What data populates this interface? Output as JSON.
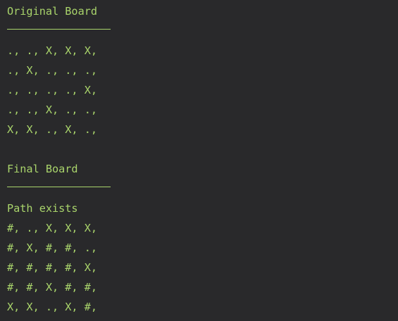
{
  "original": {
    "title": "Original Board",
    "rows": [
      "., ., X, X, X,",
      "., X, ., ., .,",
      "., ., ., ., X,",
      "., ., X, ., .,",
      "X, X, ., X, .,"
    ]
  },
  "final": {
    "title": "Final Board",
    "status": "Path exists",
    "rows": [
      "#, ., X, X, X,",
      "#, X, #, #, .,",
      "#, #, #, #, X,",
      "#, #, X, #, #,",
      "X, X, ., X, #,"
    ]
  },
  "colors": {
    "background": "#29292b",
    "text": "#a9d46b"
  }
}
